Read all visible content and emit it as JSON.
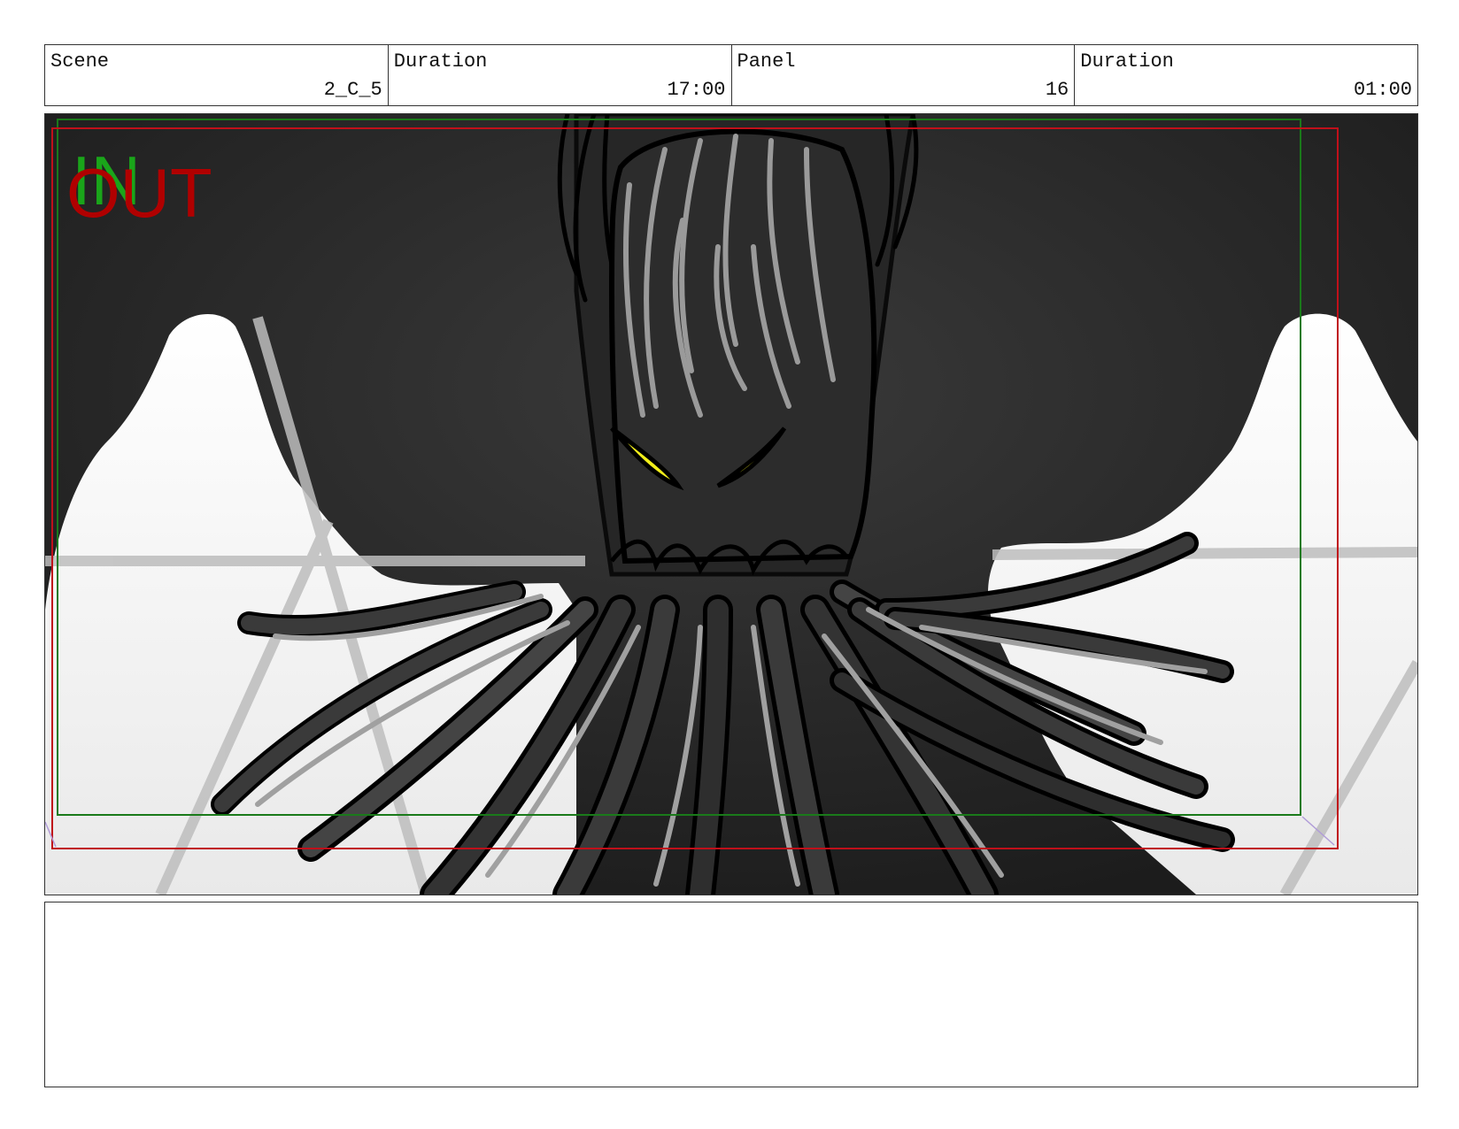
{
  "header": {
    "scene_label": "Scene",
    "scene_value": "2_C_5",
    "duration_label": "Duration",
    "duration_value": "17:00",
    "panel_label": "Panel",
    "panel_value": "16",
    "panel_duration_label": "Duration",
    "panel_duration_value": "01:00"
  },
  "frame": {
    "in_text": "IN",
    "out_text": "OUT",
    "safe_in_color": "#1a7a1a",
    "safe_out_color": "#c0101a",
    "eye_color": "#f2ef1a"
  },
  "notes": {
    "text": ""
  }
}
